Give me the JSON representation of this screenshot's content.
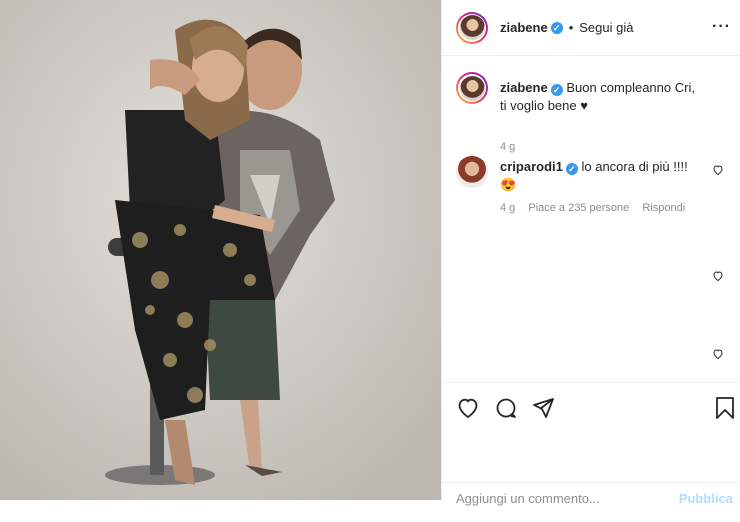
{
  "post": {
    "username": "ziabene",
    "follow_status": "Segui già",
    "more_icon": "more-dots-icon"
  },
  "caption": {
    "username": "ziabene",
    "text": "Buon compleanno Cri, ti voglio bene ♥",
    "time": "4 g"
  },
  "comments": [
    {
      "username": "criparodi1",
      "text": "lo ancora di più !!!!",
      "emoji": "😍",
      "time": "4 g",
      "likes": "Piace a 235 persone",
      "reply": "Rispondi"
    }
  ],
  "footer": {
    "add_comment_placeholder": "Aggiungi un commento...",
    "publish_label": "Pubblica"
  },
  "icons": {
    "like": "heart-icon",
    "comment": "comment-icon",
    "share": "share-icon",
    "save": "bookmark-icon"
  },
  "colors": {
    "verified": "#3897f0",
    "publish": "#b3dbff",
    "secondary_text": "#8e8e8e"
  }
}
